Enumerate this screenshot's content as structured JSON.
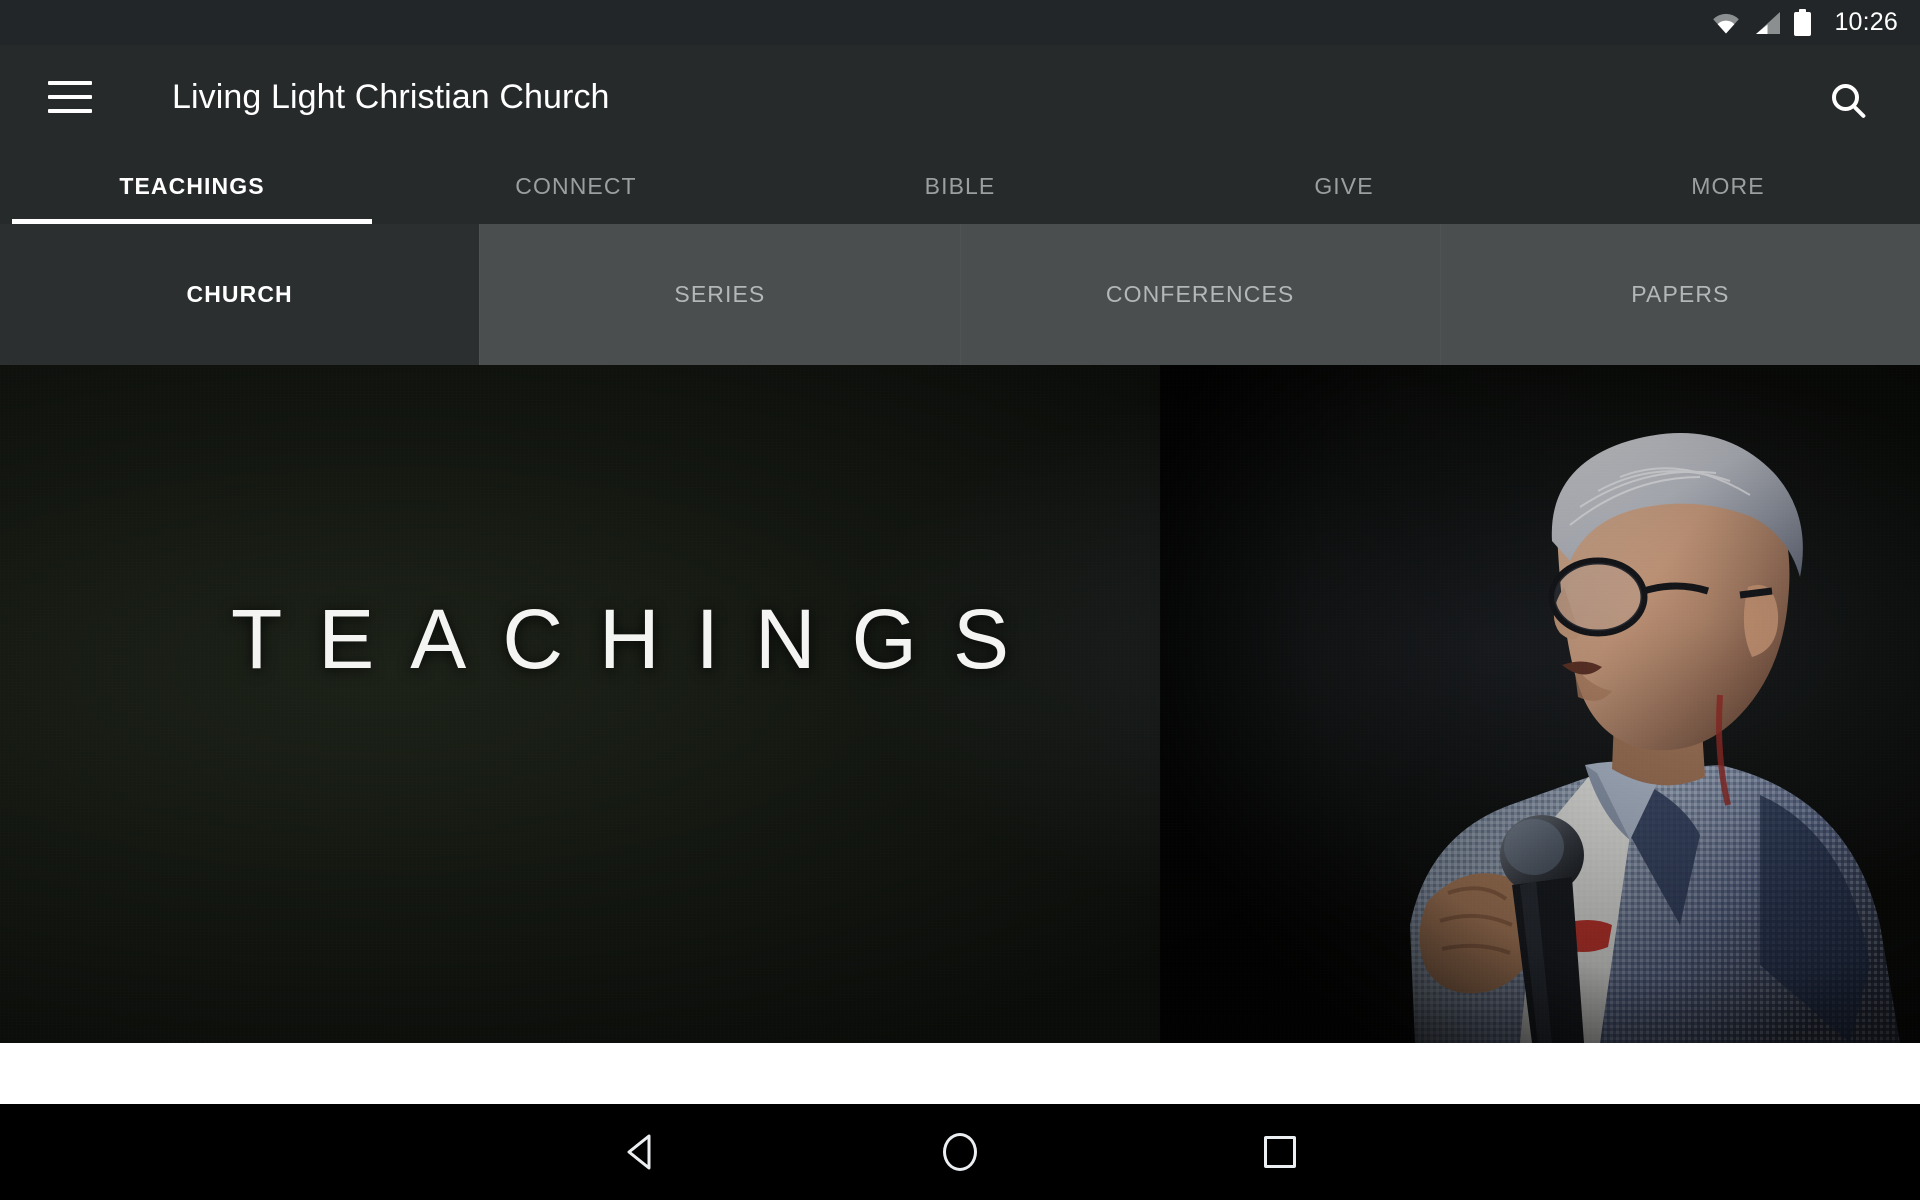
{
  "statusbar": {
    "time": "10:26",
    "icons": [
      "wifi-icon",
      "cell-signal-icon",
      "battery-icon"
    ]
  },
  "appbar": {
    "menu_icon": "hamburger-menu-icon",
    "title": "Living Light Christian Church",
    "search_icon": "search-icon"
  },
  "primary_tabs": {
    "active_index": 0,
    "items": [
      {
        "label": "TEACHINGS"
      },
      {
        "label": "CONNECT"
      },
      {
        "label": "BIBLE"
      },
      {
        "label": "GIVE"
      },
      {
        "label": "MORE"
      }
    ]
  },
  "secondary_tabs": {
    "active_index": 0,
    "items": [
      {
        "label": "CHURCH"
      },
      {
        "label": "SERIES"
      },
      {
        "label": "CONFERENCES"
      },
      {
        "label": "PAPERS"
      }
    ]
  },
  "hero": {
    "title": "TEACHINGS",
    "image_description": "Man with grey hair and glasses speaking into a handheld microphone on a dark stage, wearing a blue checkered button-up shirt"
  },
  "navbar": {
    "back_icon": "back-triangle-icon",
    "home_icon": "home-circle-icon",
    "recents_icon": "recents-square-icon"
  },
  "colors": {
    "appbar_bg": "#262a2b",
    "status_bg": "#222628",
    "secondary_tab_bg": "#4b4e4e",
    "secondary_tab_active_bg": "#2b2f30",
    "active_indicator": "#ffffff",
    "inactive_label": "#9c9fa0",
    "content_bg": "#ffffff",
    "navbar_bg": "#000000"
  }
}
